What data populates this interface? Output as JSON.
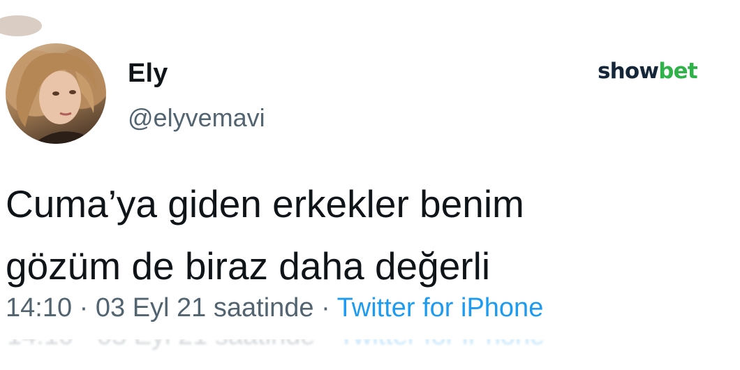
{
  "tweet": {
    "author": {
      "display_name": "Ely",
      "handle": "@elyvemavi"
    },
    "text_lines": [
      "Cuma’ya giden erkekler benim",
      "gözüm de biraz daha değerli"
    ],
    "meta": {
      "time": "14:10",
      "separator": "·",
      "date": "03 Eyl 21 saatinde",
      "source": "Twitter for iPhone"
    }
  },
  "brand": {
    "part1": "show",
    "part2": "bet",
    "color_part1": "#152638",
    "color_part2": "#2fb24a"
  },
  "colors": {
    "text_primary": "#0f1419",
    "text_secondary": "#536471",
    "link": "#1d9bf0"
  }
}
